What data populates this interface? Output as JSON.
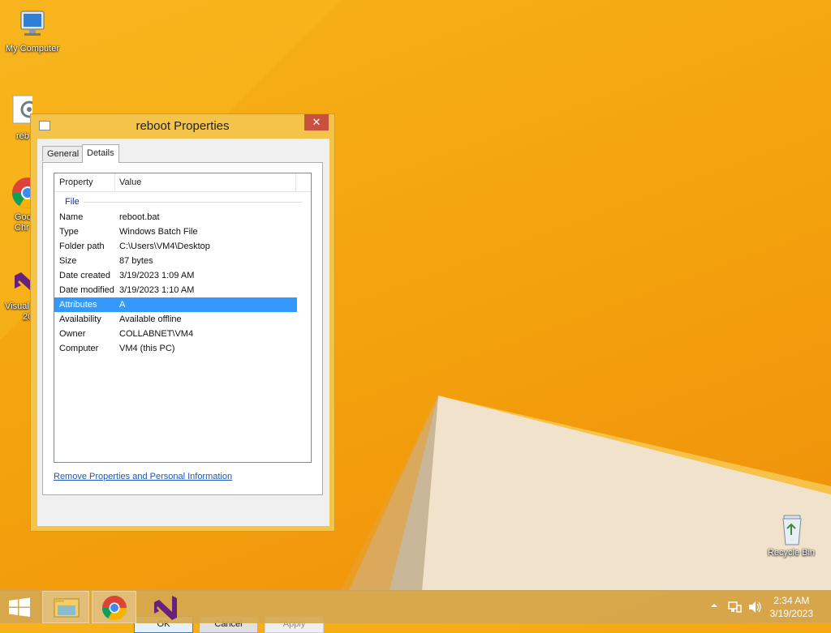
{
  "desktop": {
    "icons": [
      {
        "label": "My Computer"
      },
      {
        "label": "reb"
      },
      {
        "label": "Goo",
        "label2": "Chr"
      },
      {
        "label": "Visual",
        "label2": "20"
      },
      {
        "label": "Recycle Bin"
      }
    ]
  },
  "dialog": {
    "title": "reboot Properties",
    "close": "✕",
    "tabs": [
      "General",
      "Details"
    ],
    "columns": {
      "property": "Property",
      "value": "Value"
    },
    "group": "File",
    "rows": [
      {
        "k": "Name",
        "v": "reboot.bat"
      },
      {
        "k": "Type",
        "v": "Windows Batch File"
      },
      {
        "k": "Folder path",
        "v": "C:\\Users\\VM4\\Desktop"
      },
      {
        "k": "Size",
        "v": "87 bytes"
      },
      {
        "k": "Date created",
        "v": "3/19/2023 1:09 AM"
      },
      {
        "k": "Date modified",
        "v": "3/19/2023 1:10 AM"
      },
      {
        "k": "Attributes",
        "v": "A"
      },
      {
        "k": "Availability",
        "v": "Available offline"
      },
      {
        "k": "Owner",
        "v": "COLLABNET\\VM4"
      },
      {
        "k": "Computer",
        "v": "VM4 (this PC)"
      }
    ],
    "link": "Remove Properties and Personal Information",
    "buttons": {
      "ok": "OK",
      "cancel": "Cancel",
      "apply": "Apply"
    }
  },
  "taskbar": {
    "clock_time": "2:34 AM",
    "clock_date": "3/19/2023",
    "apps": [
      "start-button",
      "file-explorer",
      "google-chrome",
      "visual-studio"
    ]
  },
  "colors": {
    "selection": "#3399ff",
    "dialog_frame": "#f4c34a",
    "close": "#c7503f"
  }
}
